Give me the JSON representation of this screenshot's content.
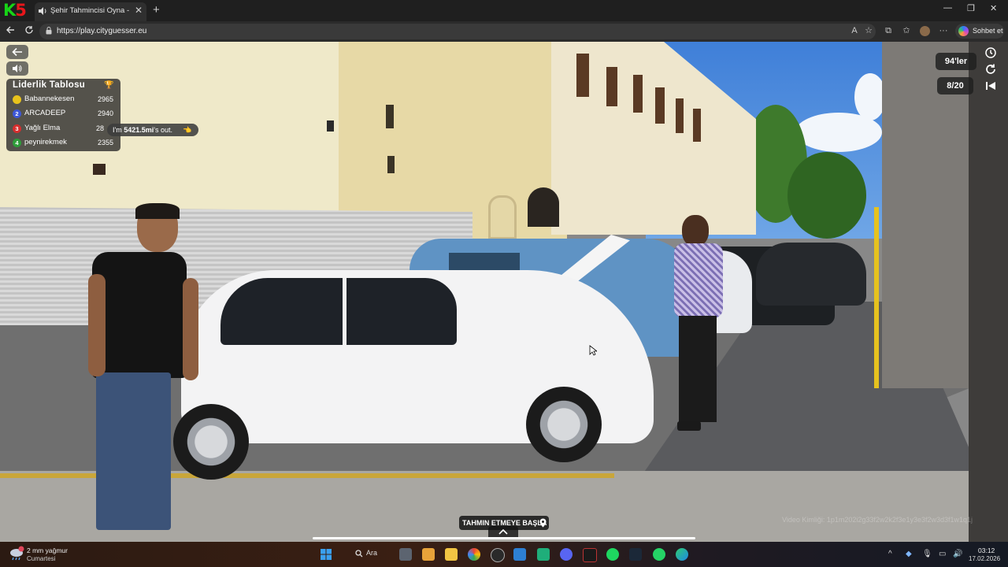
{
  "browser": {
    "logo_text_k": "K",
    "logo_text_n": "5",
    "tab_title": "Şehir Tahmincisi Oyna - Dünya",
    "tab_close": "✕",
    "new_tab": "+",
    "url": "https://play.cityguesser.eu",
    "copilot_label": "Sohbet et",
    "window_controls": [
      "—",
      "❐",
      "✕"
    ]
  },
  "game": {
    "leaderboard": {
      "title": "Liderlik Tablosu",
      "rows": [
        {
          "rank": "1",
          "name": "Babannekesen",
          "score": "2965",
          "color": "#e8c31c"
        },
        {
          "rank": "2",
          "name": "ARCADEEP",
          "score": "2940",
          "color": "#3d57d6"
        },
        {
          "rank": "3",
          "name": "Yağlı Elma",
          "score": "28",
          "color": "#d62e2e"
        },
        {
          "rank": "4",
          "name": "peynirekmek",
          "score": "2355",
          "color": "#2e9d3a"
        }
      ]
    },
    "chat_bubble": {
      "text_prefix": "I'm ",
      "distance": "5421.5mi",
      "text_suffix": "'s out."
    },
    "decade_label": "94'ler",
    "round_label": "8/20",
    "guess_button": "TAHMIN ETMEYE BAŞLA",
    "video_id": "Video Kimliği: 1p1m202i2g33f2w2k2f3e1y3e3f2w3d3f1w1q1j",
    "colors": {
      "accent_gold": "#f0b928",
      "overlay_bg": "#282828"
    }
  },
  "taskbar": {
    "weather_line1": "2 mm yağmur",
    "weather_line2": "Cumartesi",
    "search_label": "Ara",
    "time": "03:12",
    "date": "17.02.2026"
  }
}
